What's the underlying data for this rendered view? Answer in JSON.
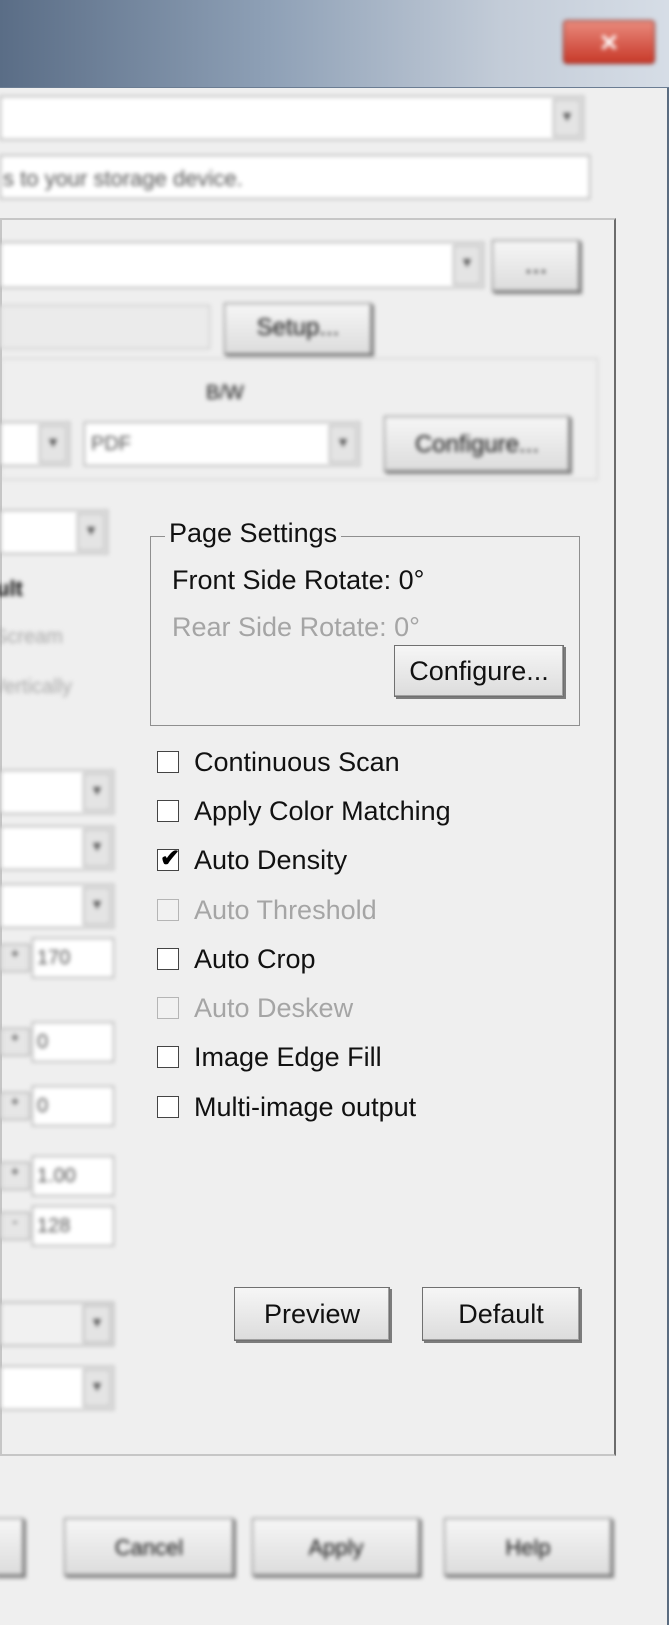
{
  "window": {
    "close_glyph": "✕"
  },
  "top_combo": {
    "value": "",
    "arrow_icon": "▼"
  },
  "description": {
    "text": "s to your storage device."
  },
  "device_combo": {
    "value": "",
    "arrow_icon": "▼"
  },
  "browse_button": {
    "label": "..."
  },
  "setup_button": {
    "label": "Setup..."
  },
  "output": {
    "bw_label": "B/W",
    "left_combo_arrow": "▼",
    "format_combo": {
      "value": "PDF",
      "arrow_icon": "▼"
    },
    "configure_label": "Configure..."
  },
  "left_column": {
    "combo_arrow": "▼",
    "partial_texts": [
      "ult",
      "Scream",
      "Vertically"
    ],
    "spin_values": [
      "170",
      "0",
      "0",
      "1.00",
      "128"
    ],
    "spin_glyphs": [
      "+",
      "+",
      "+",
      "+",
      "-"
    ]
  },
  "page_settings": {
    "title": "Page Settings",
    "front_rotate": "Front Side Rotate: 0°",
    "rear_rotate": "Rear Side Rotate: 0°",
    "configure_label": "Configure..."
  },
  "options": [
    {
      "label": "Continuous Scan",
      "checked": false,
      "disabled": false
    },
    {
      "label": "Apply Color Matching",
      "checked": false,
      "disabled": false
    },
    {
      "label": "Auto Density",
      "checked": true,
      "disabled": false
    },
    {
      "label": "Auto Threshold",
      "checked": false,
      "disabled": true
    },
    {
      "label": "Auto Crop",
      "checked": false,
      "disabled": false
    },
    {
      "label": "Auto Deskew",
      "checked": false,
      "disabled": true
    },
    {
      "label": "Image Edge Fill",
      "checked": false,
      "disabled": false
    },
    {
      "label": "Multi-image output",
      "checked": false,
      "disabled": false
    }
  ],
  "check_mark": "✔",
  "preview_button": {
    "label": "Preview"
  },
  "default_button": {
    "label": "Default"
  },
  "footer": {
    "cancel_label": "Cancel",
    "apply_label": "Apply",
    "help_label": "Help"
  }
}
